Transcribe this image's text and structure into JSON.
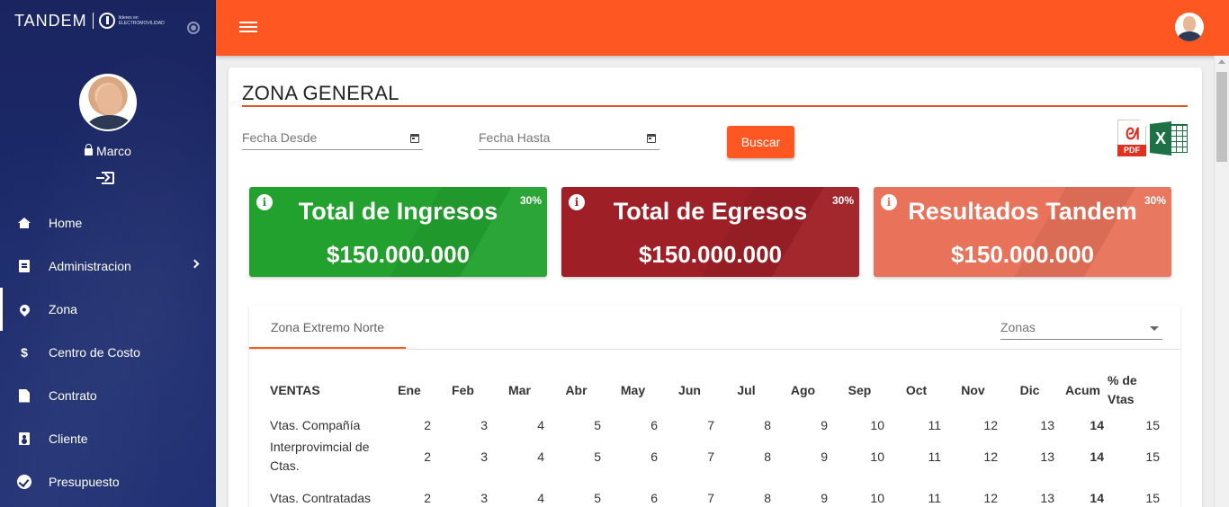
{
  "sidebar": {
    "brand": "TANDEM",
    "brand_tagline": "líderes en ELECTROMOVILIDAD",
    "user_name": "Marco",
    "nav": [
      {
        "label": "Home",
        "icon": "home-icon"
      },
      {
        "label": "Administracion",
        "icon": "clipboard-icon",
        "has_submenu": true
      },
      {
        "label": "Zona",
        "icon": "map-pin-icon",
        "active": true
      },
      {
        "label": "Centro de Costo",
        "icon": "dollar-icon"
      },
      {
        "label": "Contrato",
        "icon": "file-icon"
      },
      {
        "label": "Cliente",
        "icon": "contact-icon"
      },
      {
        "label": "Presupuesto",
        "icon": "check-circle-icon"
      }
    ]
  },
  "topbar": {
    "accent": "#ff5722"
  },
  "page": {
    "title": "ZONA GENERAL",
    "fecha_desde_placeholder": "Fecha Desde",
    "fecha_hasta_placeholder": "Fecha Hasta",
    "buscar_label": "Buscar",
    "pdf_label": "PDF"
  },
  "stats": [
    {
      "title": "Total de Ingresos",
      "value": "$150.000.000",
      "pct": "30%",
      "color": "#23a12f"
    },
    {
      "title": "Total de Egresos",
      "value": "$150.000.000",
      "pct": "30%",
      "color": "#9e1f26"
    },
    {
      "title": "Resultados Tandem",
      "value": "$150.000.000",
      "pct": "30%",
      "color": "#e8735a"
    }
  ],
  "panel": {
    "tab_label": "Zona Extremo Norte",
    "zonas_placeholder": "Zonas"
  },
  "table": {
    "headers": [
      "VENTAS",
      "Ene",
      "Feb",
      "Mar",
      "Abr",
      "May",
      "Jun",
      "Jul",
      "Ago",
      "Sep",
      "Oct",
      "Nov",
      "Dic",
      "Acum",
      "% de Vtas"
    ],
    "rows": [
      {
        "label": "Vtas. Compañía",
        "values": [
          "2",
          "3",
          "4",
          "5",
          "6",
          "7",
          "8",
          "9",
          "10",
          "11",
          "12",
          "13",
          "14",
          "15"
        ]
      },
      {
        "label": "Interprovimcial de Ctas.",
        "values": [
          "2",
          "3",
          "4",
          "5",
          "6",
          "7",
          "8",
          "9",
          "10",
          "11",
          "12",
          "13",
          "14",
          "15"
        ]
      },
      {
        "label": "Vtas. Contratadas",
        "values": [
          "2",
          "3",
          "4",
          "5",
          "6",
          "7",
          "8",
          "9",
          "10",
          "11",
          "12",
          "13",
          "14",
          "15"
        ]
      }
    ]
  }
}
